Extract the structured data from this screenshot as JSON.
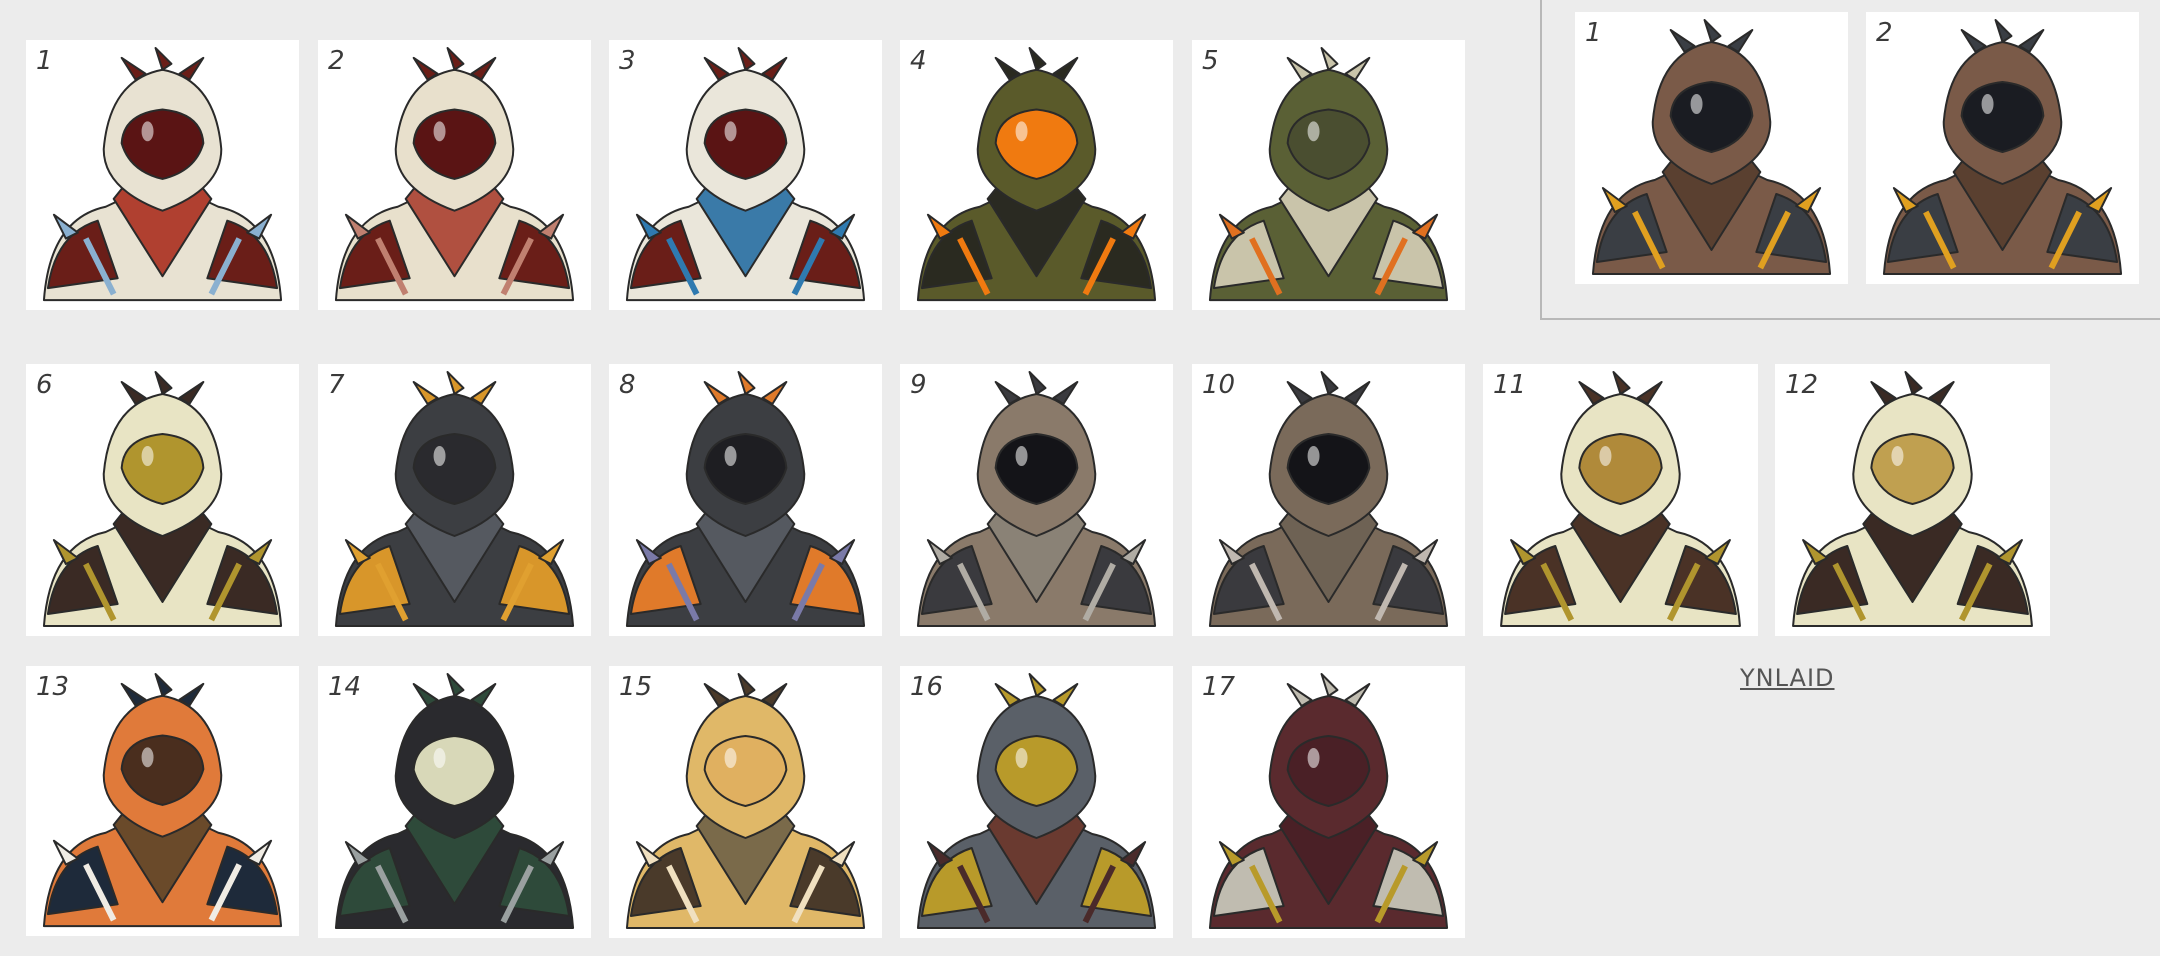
{
  "cards": [
    {
      "label": "1",
      "colors": {
        "main": "#e8e2d2",
        "accent": "#6a1e18",
        "trim": "#8ab0d0",
        "visor": "#5a1414",
        "scarf": "#b04030"
      }
    },
    {
      "label": "2",
      "colors": {
        "main": "#e8e0cc",
        "accent": "#6a1e18",
        "trim": "#c08070",
        "visor": "#5a1414",
        "scarf": "#b05040"
      }
    },
    {
      "label": "3",
      "colors": {
        "main": "#eae6da",
        "accent": "#6a1e18",
        "trim": "#2f7ab0",
        "visor": "#5a1414",
        "scarf": "#3a7aa8"
      }
    },
    {
      "label": "4",
      "colors": {
        "main": "#5a5a2a",
        "accent": "#2a2a20",
        "trim": "#f07a10",
        "visor": "#f07a10",
        "scarf": "#2a2a22"
      }
    },
    {
      "label": "5",
      "colors": {
        "main": "#5a6035",
        "accent": "#c9c4aa",
        "trim": "#e07020",
        "visor": "#4a4e30",
        "scarf": "#c9c4aa"
      }
    },
    {
      "label": "1",
      "colors": {
        "main": "#7a5a48",
        "accent": "#3a3e44",
        "trim": "#e0a020",
        "visor": "#1a1c22",
        "scarf": "#5a4030"
      }
    },
    {
      "label": "2",
      "colors": {
        "main": "#7a5a48",
        "accent": "#3a3e44",
        "trim": "#e0a020",
        "visor": "#1a1c22",
        "scarf": "#5a4030"
      }
    },
    {
      "label": "6",
      "colors": {
        "main": "#e8e4c4",
        "accent": "#3a2a24",
        "trim": "#b0952e",
        "visor": "#b0952e",
        "scarf": "#3a2a24"
      }
    },
    {
      "label": "7",
      "colors": {
        "main": "#3c3e42",
        "accent": "#d8962a",
        "trim": "#e0a030",
        "visor": "#2a2a2e",
        "scarf": "#555960"
      }
    },
    {
      "label": "8",
      "colors": {
        "main": "#3c3e42",
        "accent": "#e07a2a",
        "trim": "#7a7aa8",
        "visor": "#1e1e22",
        "scarf": "#555960"
      }
    },
    {
      "label": "9",
      "colors": {
        "main": "#8a7a6a",
        "accent": "#3a3a3e",
        "trim": "#b0aca4",
        "visor": "#141418",
        "scarf": "#8a8276"
      }
    },
    {
      "label": "10",
      "colors": {
        "main": "#7a6a5a",
        "accent": "#3a3a3e",
        "trim": "#c0b8b0",
        "visor": "#141418",
        "scarf": "#6e6254"
      }
    },
    {
      "label": "11",
      "colors": {
        "main": "#e8e4c4",
        "accent": "#4a3226",
        "trim": "#b0952e",
        "visor": "#b08a3a",
        "scarf": "#4a3226"
      }
    },
    {
      "label": "12",
      "colors": {
        "main": "#e8e4c4",
        "accent": "#3a2a24",
        "trim": "#b0952e",
        "visor": "#c0a050",
        "scarf": "#3a2a24"
      }
    },
    {
      "label": "13",
      "colors": {
        "main": "#e07a3a",
        "accent": "#1e2a3a",
        "trim": "#f0ece4",
        "visor": "#4a2e1e",
        "scarf": "#6a4a2a"
      }
    },
    {
      "label": "14",
      "colors": {
        "main": "#2a2a2e",
        "accent": "#2e4a3a",
        "trim": "#9aa0a0",
        "visor": "#d8d8b8",
        "scarf": "#2e4a3a"
      }
    },
    {
      "label": "15",
      "colors": {
        "main": "#e0b868",
        "accent": "#4a3a2a",
        "trim": "#f0e0c0",
        "visor": "#e0b060",
        "scarf": "#7a6a4a"
      }
    },
    {
      "label": "16",
      "colors": {
        "main": "#5a6068",
        "accent": "#b89a2a",
        "trim": "#4a2a2a",
        "visor": "#b89a2a",
        "scarf": "#6a3a30"
      }
    },
    {
      "label": "17",
      "colors": {
        "main": "#5a2a2e",
        "accent": "#c0bcb0",
        "trim": "#b89a2a",
        "visor": "#4a2026",
        "scarf": "#4a2026"
      }
    }
  ],
  "signature": "YNLAID"
}
